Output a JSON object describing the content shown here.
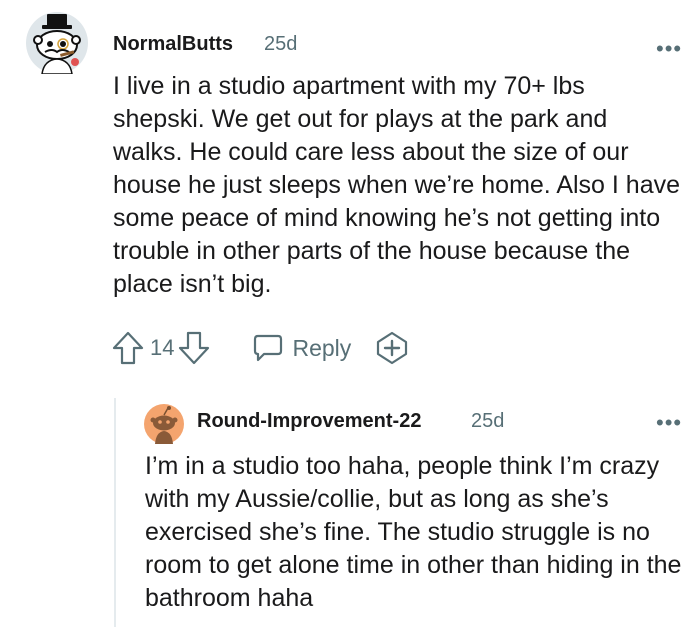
{
  "comment": {
    "username": "NormalButts",
    "age": "25d",
    "more_label": "•••",
    "body": "I live in a studio apartment with my 70+ lbs shepski. We get out for plays at the park and walks. He could care less about the size of our house he just sleeps when we’re home. Also I have some peace of mind knowing he’s not getting into trouble in other parts of the house because the place isn’t big.",
    "score": "14",
    "reply_label": "Reply",
    "avatar_icon": "snoo-top-hat-avatar",
    "upvote_icon": "upvote-arrow-icon",
    "downvote_icon": "downvote-arrow-icon",
    "reply_icon": "speech-bubble-icon",
    "award_icon": "add-award-icon"
  },
  "reply": {
    "username": "Round-Improvement-22",
    "age": "25d",
    "more_label": "•••",
    "body": "I’m in a studio too haha, people think I’m crazy with my Aussie/collie, but as long as she’s exercised she’s fine. The studio struggle is no room to get alone time in other than hiding in the bathroom haha",
    "avatar_icon": "snoo-default-orange-avatar"
  },
  "colors": {
    "text": "#1a1a1b",
    "meta": "#576f76",
    "thread_line": "#e5ebee",
    "avatar_orange": "#f4a46e"
  }
}
